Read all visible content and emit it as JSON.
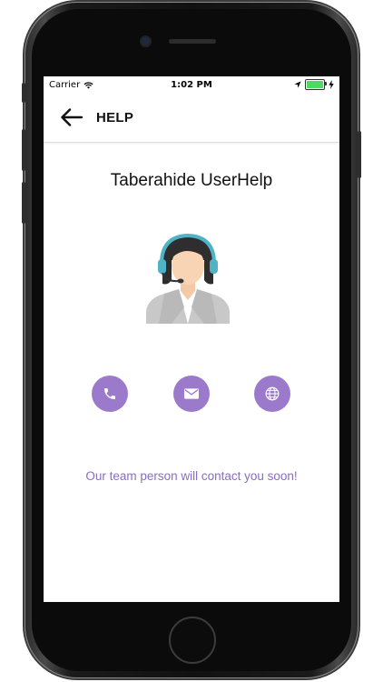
{
  "status_bar": {
    "carrier": "Carrier",
    "time": "1:02 PM",
    "icons": [
      "wifi-icon",
      "location-arrow-icon",
      "battery-icon",
      "charging-bolt-icon"
    ],
    "battery_level": 1.0
  },
  "navbar": {
    "back_icon": "arrow-left-icon",
    "title": "HELP"
  },
  "content": {
    "heading": "Taberahide UserHelp",
    "avatar_icon": "support-agent-headset-icon",
    "actions": [
      {
        "name": "phone",
        "icon": "phone-icon"
      },
      {
        "name": "email",
        "icon": "envelope-icon"
      },
      {
        "name": "website",
        "icon": "globe-icon"
      }
    ],
    "message": "Our team person will contact you soon!"
  },
  "colors": {
    "accent": "#9c7acb",
    "message_text": "#8a6cc4",
    "headset": "#4fb3c6",
    "battery": "#4cd964"
  }
}
